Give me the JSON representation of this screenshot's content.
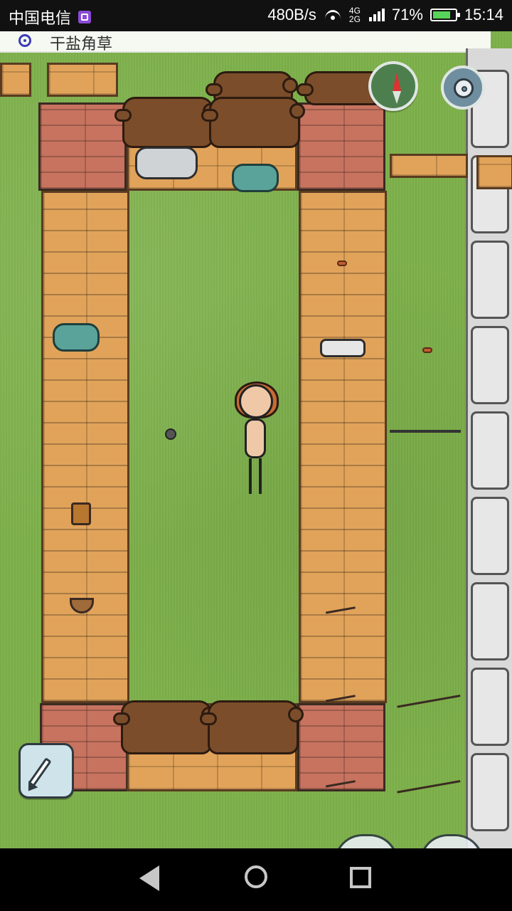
{
  "status_bar": {
    "carrier": "中国电信",
    "speed": "480B/s",
    "network": "4G 2G",
    "battery": "71%",
    "time": "15:14"
  },
  "top_hint": {
    "text": "干盐角草"
  },
  "ui": {
    "compass_icon": "compass-icon",
    "settings_icon": "gear-icon",
    "pencil_icon": "pencil-icon"
  },
  "navigation": {
    "back": "back",
    "home": "home",
    "recent": "recent"
  }
}
